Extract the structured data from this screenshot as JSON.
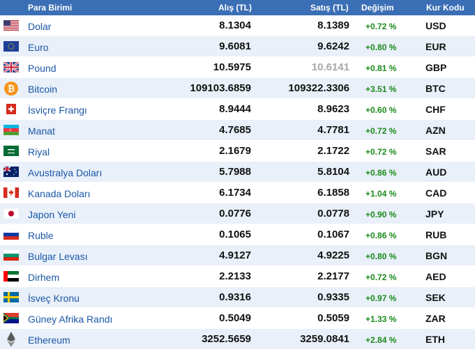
{
  "header": {
    "currency": "Para Birimi",
    "buy": "Alış (TL)",
    "sell": "Satış (TL)",
    "change": "Değişim",
    "code": "Kur Kodu"
  },
  "rows": [
    {
      "name": "Dolar",
      "buy": "8.1304",
      "sell": "8.1389",
      "change": "+0.72 %",
      "code": "USD",
      "flag": "us-flag-icon"
    },
    {
      "name": "Euro",
      "buy": "9.6081",
      "sell": "9.6242",
      "change": "+0.80 %",
      "code": "EUR",
      "flag": "eu-flag-icon"
    },
    {
      "name": "Pound",
      "buy": "10.5975",
      "sell": "10.6141",
      "change": "+0.81 %",
      "code": "GBP",
      "flag": "uk-flag-icon"
    },
    {
      "name": "Bitcoin",
      "buy": "109103.6859",
      "sell": "109322.3306",
      "change": "+3.51 %",
      "code": "BTC",
      "flag": "bitcoin-icon"
    },
    {
      "name": "İsviçre Frangı",
      "buy": "8.9444",
      "sell": "8.9623",
      "change": "+0.60 %",
      "code": "CHF",
      "flag": "swiss-flag-icon"
    },
    {
      "name": "Manat",
      "buy": "4.7685",
      "sell": "4.7781",
      "change": "+0.72 %",
      "code": "AZN",
      "flag": "azerbaijan-flag-icon"
    },
    {
      "name": "Riyal",
      "buy": "2.1679",
      "sell": "2.1722",
      "change": "+0.72 %",
      "code": "SAR",
      "flag": "saudi-flag-icon"
    },
    {
      "name": "Avustralya Doları",
      "buy": "5.7988",
      "sell": "5.8104",
      "change": "+0.86 %",
      "code": "AUD",
      "flag": "australia-flag-icon"
    },
    {
      "name": "Kanada Doları",
      "buy": "6.1734",
      "sell": "6.1858",
      "change": "+1.04 %",
      "code": "CAD",
      "flag": "canada-flag-icon"
    },
    {
      "name": "Japon Yeni",
      "buy": "0.0776",
      "sell": "0.0778",
      "change": "+0.90 %",
      "code": "JPY",
      "flag": "japan-flag-icon"
    },
    {
      "name": "Ruble",
      "buy": "0.1065",
      "sell": "0.1067",
      "change": "+0.86 %",
      "code": "RUB",
      "flag": "russia-flag-icon"
    },
    {
      "name": "Bulgar Levası",
      "buy": "4.9127",
      "sell": "4.9225",
      "change": "+0.80 %",
      "code": "BGN",
      "flag": "bulgaria-flag-icon"
    },
    {
      "name": "Dirhem",
      "buy": "2.2133",
      "sell": "2.2177",
      "change": "+0.72 %",
      "code": "AED",
      "flag": "uae-flag-icon"
    },
    {
      "name": "İsveç Kronu",
      "buy": "0.9316",
      "sell": "0.9335",
      "change": "+0.97 %",
      "code": "SEK",
      "flag": "sweden-flag-icon"
    },
    {
      "name": "Güney Afrika Randı",
      "buy": "0.5049",
      "sell": "0.5059",
      "change": "+1.33 %",
      "code": "ZAR",
      "flag": "south-africa-flag-icon"
    },
    {
      "name": "Ethereum",
      "buy": "3252.5659",
      "sell": "3259.0841",
      "change": "+2.84 %",
      "code": "ETH",
      "flag": "ethereum-icon"
    }
  ],
  "colors": {
    "header_bg": "#3b6fb5",
    "row_alt": "#e9f0f9",
    "link": "#1a56a6",
    "positive": "#1a8a1a",
    "muted_value": "#a8a8a8"
  }
}
